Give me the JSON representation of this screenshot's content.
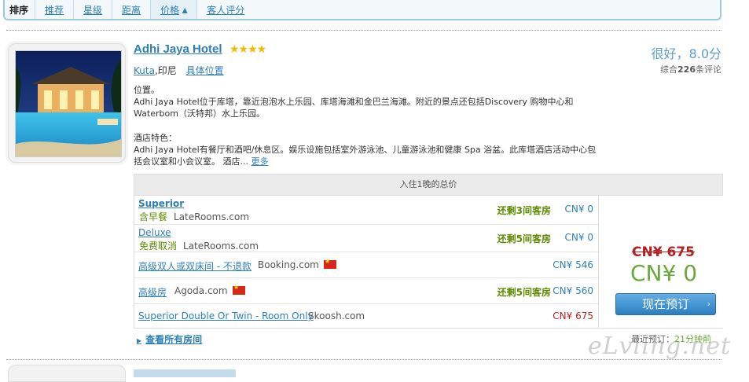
{
  "sort": {
    "label": "排序",
    "options": [
      "推荐",
      "星级",
      "距离",
      "价格",
      "客人评分"
    ]
  },
  "hotel": {
    "name": "Adhi Jaya Hotel",
    "stars": "★★★★",
    "city": "Kuta",
    "country": "印尼",
    "map_link": "具体位置",
    "rating_text": "很好，8.0分",
    "reviews_prefix": "综合",
    "reviews_count": "226",
    "reviews_suffix": "条评论",
    "desc_title1": "位置。",
    "desc_p1": "Adhi Jaya Hotel位于库塔，靠近泡泡水上乐园、库塔海滩和金巴兰海滩。附近的景点还包括Discovery 购物中心和Waterbom（沃特邦）水上乐园。",
    "desc_title2": "酒店特色：",
    "desc_p2": "Adhi Jaya Hotel有餐厅和酒吧/休息区。娱乐设施包括室外游泳池、儿童游泳池和健康 Spa 浴盆。此库塔酒店活动中心包括会议室和小会议室。 酒店...",
    "more_link": "更多"
  },
  "price_table": {
    "header": "入住1晚的总价",
    "rows": [
      {
        "room": "Superior",
        "perk": "含早餐",
        "source": "LateRooms.com",
        "avail": "还剩3间客房",
        "price": "CN¥ 0"
      },
      {
        "room": "Deluxe",
        "perk": "免费取消",
        "source": "LateRooms.com",
        "avail": "还剩5间客房",
        "price": "CN¥ 0"
      },
      {
        "room": "高级双人或双床间 - 不退款",
        "source": "Booking.com",
        "price": "CN¥ 546"
      },
      {
        "room": "高级房",
        "source": "Agoda.com",
        "avail": "还剩5间客房",
        "price": "CN¥ 560"
      },
      {
        "room": "Superior Double Or Twin - Room Only",
        "source": "Skoosh.com",
        "price": "CN¥ 675"
      }
    ],
    "old_price": "CN¥ 675",
    "new_price": "CN¥ 0",
    "book_button": "现在预订",
    "view_all": "查看所有房间",
    "recent_label": "最近预订：",
    "recent_time": "21分钟前"
  },
  "watermark": "eLvling.net"
}
